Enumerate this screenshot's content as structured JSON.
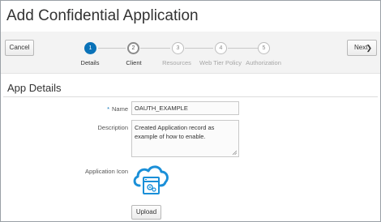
{
  "page": {
    "title": "Add Confidential Application"
  },
  "toolbar": {
    "cancel_label": "Cancel",
    "next_label": "Next",
    "next_chevron": "❯"
  },
  "train": {
    "steps": [
      {
        "number": "1",
        "label": "Details",
        "state": "active"
      },
      {
        "number": "2",
        "label": "Client",
        "state": "next"
      },
      {
        "number": "3",
        "label": "Resources",
        "state": "disabled"
      },
      {
        "number": "4",
        "label": "Web Tier Policy",
        "state": "disabled"
      },
      {
        "number": "5",
        "label": "Authorization",
        "state": "disabled"
      }
    ]
  },
  "section": {
    "title": "App Details"
  },
  "form": {
    "required_marker": "*",
    "name_label": "Name",
    "name_value": "OAUTH_EXAMPLE",
    "description_label": "Description",
    "description_value": "Created Application record as example of how to enable.",
    "icon_label": "Application Icon",
    "icon_name": "cloud-application-icon",
    "upload_label": "Upload"
  },
  "colors": {
    "accent": "#0a72b8",
    "icon_blue": "#1a8fd8"
  }
}
